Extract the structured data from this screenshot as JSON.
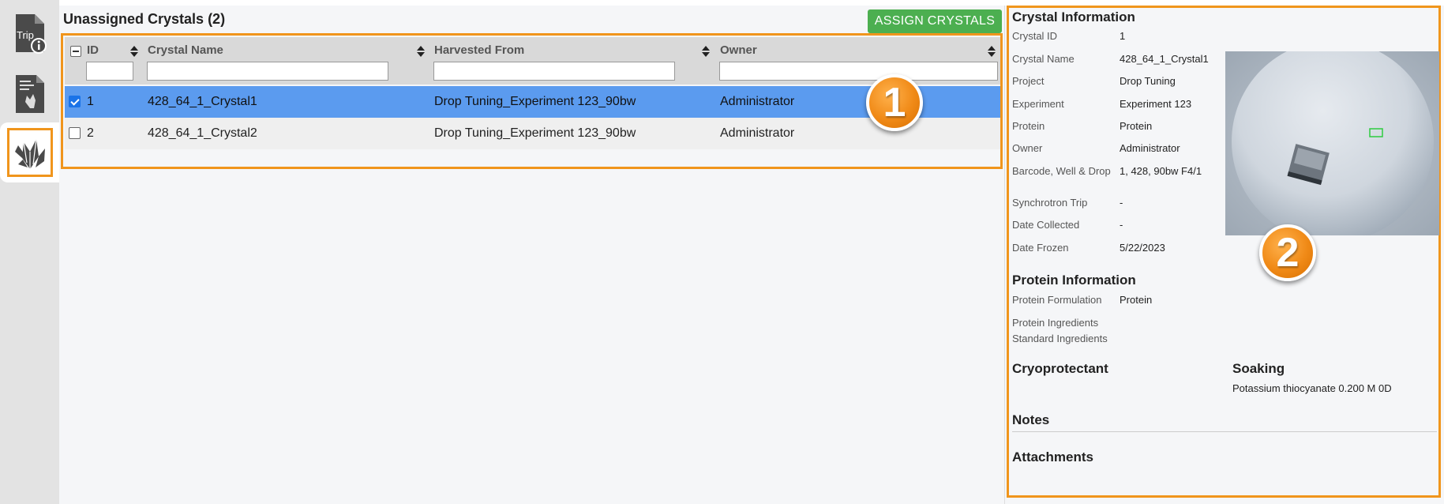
{
  "rail": {
    "trip_icon_label": "Trip",
    "items": [
      "trip-info",
      "harvest-document",
      "crystals"
    ]
  },
  "list": {
    "title": "Unassigned Crystals (2)",
    "assign_label": "ASSIGN CRYSTALS",
    "columns": [
      "ID",
      "Crystal Name",
      "Harvested From",
      "Owner"
    ],
    "rows": [
      {
        "id": "1",
        "name": "428_64_1_Crystal1",
        "harvested": "Drop Tuning_Experiment 123_90bw",
        "owner": "Administrator",
        "selected": true
      },
      {
        "id": "2",
        "name": "428_64_1_Crystal2",
        "harvested": "Drop Tuning_Experiment 123_90bw",
        "owner": "Administrator",
        "selected": false
      }
    ]
  },
  "badges": {
    "one": "1",
    "two": "2"
  },
  "colors": {
    "accent": "#f0951c",
    "assign": "#4caf50",
    "selected_row": "#5b9bef"
  },
  "details": {
    "crystal_title": "Crystal Information",
    "fields": [
      {
        "k": "Crystal ID",
        "v": "1"
      },
      {
        "k": "Crystal Name",
        "v": "428_64_1_Crystal1"
      },
      {
        "k": "Project",
        "v": "Drop Tuning"
      },
      {
        "k": "Experiment",
        "v": "Experiment 123"
      },
      {
        "k": "Protein",
        "v": "Protein"
      },
      {
        "k": "Owner",
        "v": "Administrator"
      },
      {
        "k": "Barcode, Well & Drop",
        "v": "1, 428, 90bw F4/1"
      },
      {
        "k": "Synchrotron Trip",
        "v": "-"
      },
      {
        "k": "Date Collected",
        "v": "-"
      },
      {
        "k": "Date Frozen",
        "v": "5/22/2023"
      }
    ],
    "protein_title": "Protein Information",
    "protein_formulation_label": "Protein Formulation",
    "protein_formulation_value": "Protein",
    "protein_ingredients_label": "Protein Ingredients",
    "standard_ingredients_label": "Standard Ingredients",
    "cryo_title": "Cryoprotectant",
    "soaking_title": "Soaking",
    "soaking_value": "Potassium thiocyanate 0.200 M 0D",
    "notes_title": "Notes",
    "attachments_title": "Attachments"
  }
}
